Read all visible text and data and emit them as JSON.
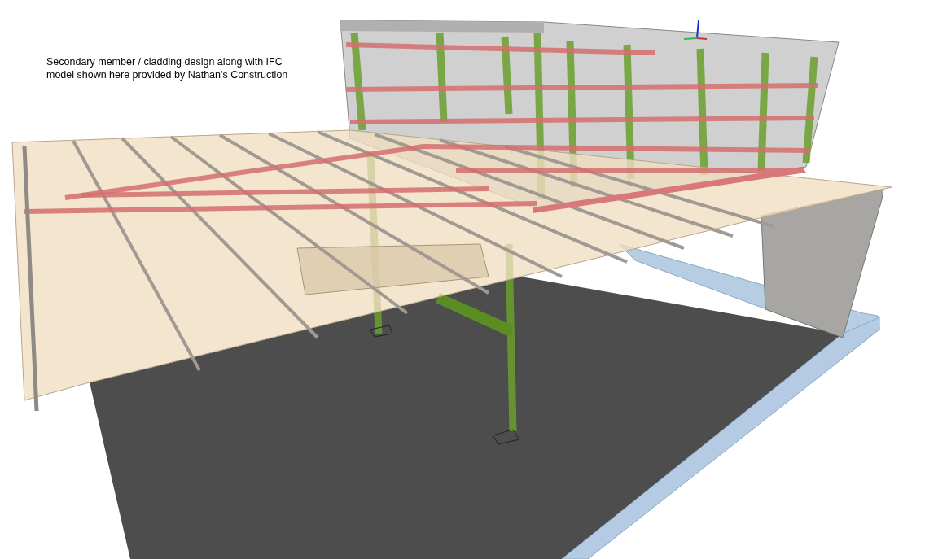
{
  "caption": {
    "lines": [
      "Secondary member / cladding design along with IFC",
      "model shown here provided by Nathan's Construction"
    ]
  }
}
